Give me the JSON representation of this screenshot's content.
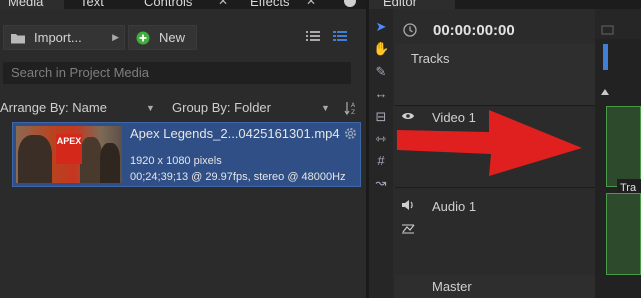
{
  "tabs": [
    {
      "label": "Media",
      "active": true
    },
    {
      "label": "Text",
      "active": false
    },
    {
      "label": "Controls",
      "active": false
    },
    {
      "label": "Effects",
      "active": false
    }
  ],
  "toolbar": {
    "import_label": "Import...",
    "new_label": "New",
    "search_placeholder": "Search in Project Media"
  },
  "arrange": {
    "label": "Arrange By: Name"
  },
  "group": {
    "label": "Group By: Folder"
  },
  "media_item": {
    "filename": "Apex Legends_2...0425161301.mp4",
    "resolution": "1920 x 1080 pixels",
    "details": "00;24;39;13 @ 29.97fps, stereo @ 48000Hz",
    "thumb_logo": "APEX"
  },
  "editor": {
    "tab_label": "Editor",
    "timecode": "00:00:00:00",
    "tracks_label": "Tracks",
    "video_track": "Video 1",
    "audio_track": "Audio 1",
    "master_label": "Master",
    "clip_label": "Tra"
  },
  "colors": {
    "accent": "#2f4f86",
    "arrow": "#e0201f",
    "clip": "#2d4a2d"
  }
}
